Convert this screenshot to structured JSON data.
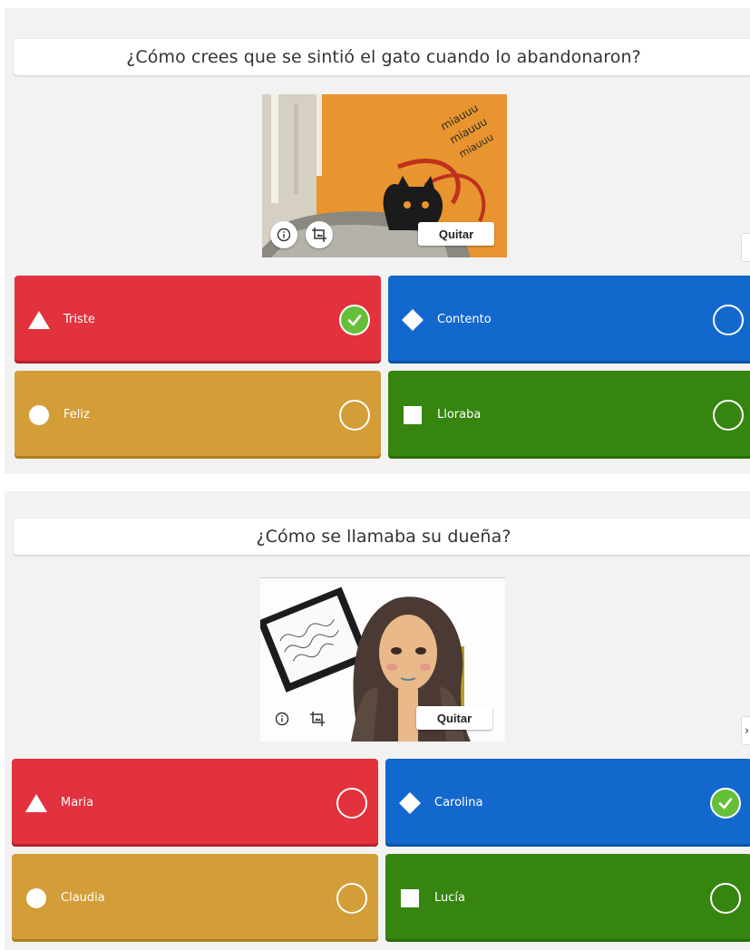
{
  "questions": [
    {
      "title": "¿Cómo crees que se sintió el gato cuando lo abandonaron?",
      "media_remove_label": "Quitar",
      "side_tab": "",
      "answers": [
        {
          "text": "Triste",
          "shape": "triangle",
          "color": "#e2323e",
          "correct": true
        },
        {
          "text": "Contento",
          "shape": "diamond",
          "color": "#1368ce",
          "correct": false
        },
        {
          "text": "Feliz",
          "shape": "circle",
          "color": "#d39d38",
          "correct": false
        },
        {
          "text": "Lloraba",
          "shape": "square",
          "color": "#378511",
          "correct": false
        }
      ]
    },
    {
      "title": "¿Cómo se llamaba su dueña?",
      "media_remove_label": "Quitar",
      "side_tab": "›",
      "answers": [
        {
          "text": "Maria",
          "shape": "triangle",
          "color": "#e2323e",
          "correct": false
        },
        {
          "text": "Carolina",
          "shape": "diamond",
          "color": "#1368ce",
          "correct": true
        },
        {
          "text": "Claudia",
          "shape": "circle",
          "color": "#d39d38",
          "correct": false
        },
        {
          "text": "Lucía",
          "shape": "square",
          "color": "#378511",
          "correct": false
        }
      ]
    }
  ],
  "colors": {
    "correct": "#66bf39",
    "panel": "#f2f2f2"
  }
}
